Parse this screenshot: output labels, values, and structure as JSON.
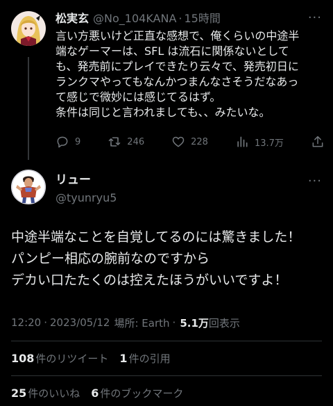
{
  "parent_tweet": {
    "display_name": "松実玄",
    "handle": "@No_104KANA",
    "separator": "·",
    "time": "15時間",
    "body_lines": [
      "言い方悪いけど正直な感想で、俺くらいの中途半",
      "端なゲーマーは、SFL は流石に関係ないとして",
      "も、発売前にプレイできたり云々で、発売初日に",
      "ランクマやってもなんかつまんなさそうだなあっ",
      "て感じで微妙には感じてるはず。",
      "条件は同じと言われましても、、みたいな。"
    ],
    "actions": {
      "reply_count": "9",
      "retweet_count": "246",
      "like_count": "228",
      "view_count": "13.7万"
    },
    "icons": [
      "reply-icon",
      "retweet-icon",
      "like-icon",
      "views-icon",
      "share-icon"
    ]
  },
  "main_tweet": {
    "display_name": "リュー",
    "handle": "@tyunryu5",
    "body_lines": [
      "中途半端なことを自覚してるのには驚きました！",
      "パンピー相応の腕前なのですから",
      "デカい口たたくのは控えたほうがいいですよ！"
    ],
    "meta": {
      "time": "12:20",
      "date": "2023/05/12",
      "location": "場所: Earth",
      "separator": "·",
      "views": "5.1万",
      "views_label": "回表示"
    },
    "stats_row1": [
      {
        "num": "108",
        "label": "件のリツイート"
      },
      {
        "num": "1",
        "label": "件の引用"
      }
    ],
    "stats_row2": [
      {
        "num": "25",
        "label": "件のいいね"
      },
      {
        "num": "6",
        "label": "件のブックマーク"
      }
    ]
  },
  "colors": {
    "background": "#000000",
    "primary_text": "#e7e9ea",
    "secondary_text": "#71767b",
    "divider": "#2f3336"
  }
}
